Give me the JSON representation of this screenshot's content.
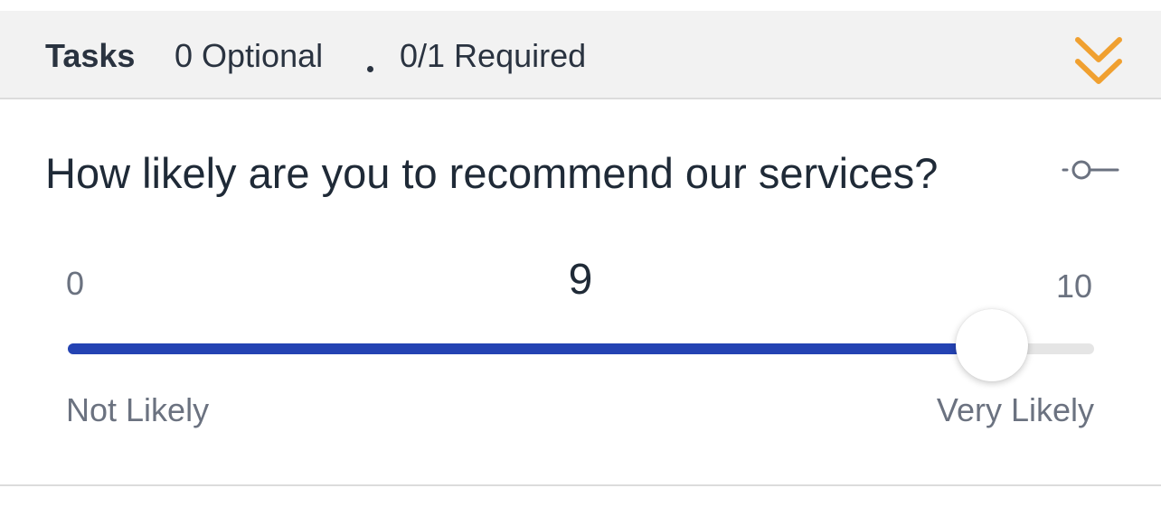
{
  "header": {
    "title": "Tasks",
    "optional": "0 Optional",
    "separator": "•",
    "required": "0/1 Required",
    "collapse_icon": "double-chevron-down-icon",
    "accent_color": "#f0a030"
  },
  "question": {
    "text": "How likely are you to recommend our services?",
    "options_icon": "slider-options-icon",
    "scale": {
      "min": "0",
      "max": "10",
      "value": "9",
      "value_fraction": 0.9,
      "min_label": "Not Likely",
      "max_label": "Very Likely"
    },
    "fill_color": "#2443b3"
  }
}
